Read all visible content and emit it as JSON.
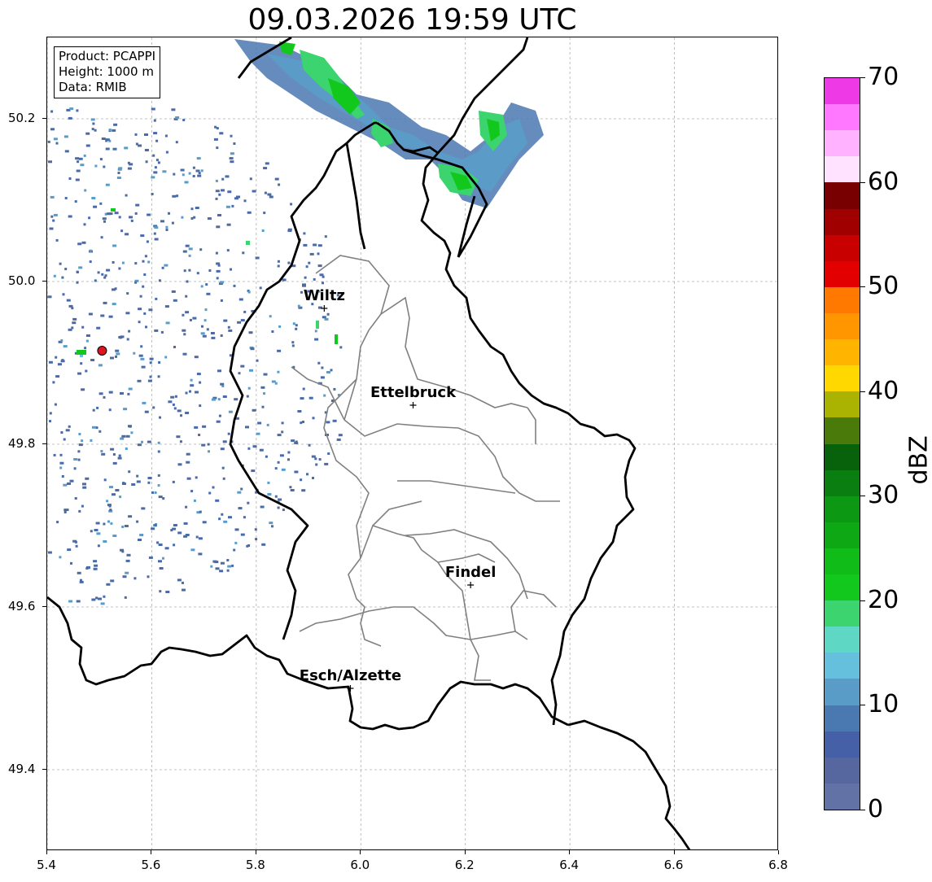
{
  "title": "09.03.2026 19:59 UTC",
  "info": {
    "product": "Product: PCAPPI",
    "height": "Height: 1000 m",
    "data": "Data: RMIB"
  },
  "axes": {
    "x_ticks": [
      "5.4",
      "5.6",
      "5.8",
      "6.0",
      "6.2",
      "6.4",
      "6.6",
      "6.8"
    ],
    "y_ticks": [
      "50.2",
      "50.0",
      "49.8",
      "49.6",
      "49.4"
    ],
    "x_range": [
      5.4,
      6.8
    ],
    "y_range": [
      49.3,
      50.3
    ],
    "grid": true
  },
  "colorbar": {
    "unit": "dBZ",
    "ticks": [
      "0",
      "10",
      "20",
      "30",
      "40",
      "50",
      "60",
      "70"
    ],
    "range": [
      0,
      70
    ],
    "colors": [
      "#6272a6",
      "#56669e",
      "#4560a6",
      "#4a78b0",
      "#5a9cc8",
      "#64c0dc",
      "#5ed8c4",
      "#3cd46e",
      "#12c81c",
      "#10bc18",
      "#0ea814",
      "#0c9812",
      "#0a7e10",
      "#08620c",
      "#4a7a0a",
      "#aab202",
      "#ffd800",
      "#ffb400",
      "#ff9600",
      "#ff7800",
      "#e20000",
      "#c80000",
      "#a00000",
      "#780000",
      "#ffe2ff",
      "#ffb2ff",
      "#ff78ff",
      "#ee3ae6"
    ]
  },
  "cities": [
    {
      "name": "Wiltz",
      "lon": 5.93,
      "lat": 49.967
    },
    {
      "name": "Ettelbruck",
      "lon": 6.1,
      "lat": 49.848
    },
    {
      "name": "Findel",
      "lon": 6.21,
      "lat": 49.627
    },
    {
      "name": "Esch/Alzette",
      "lon": 5.98,
      "lat": 49.5
    }
  ],
  "radar_site": {
    "lon": 5.505,
    "lat": 49.915,
    "color": "#e0141e"
  },
  "colors": {
    "border": "#000000",
    "canton": "#808080",
    "grid": "#b0b0b0",
    "clutter": "#4a6aa8"
  }
}
